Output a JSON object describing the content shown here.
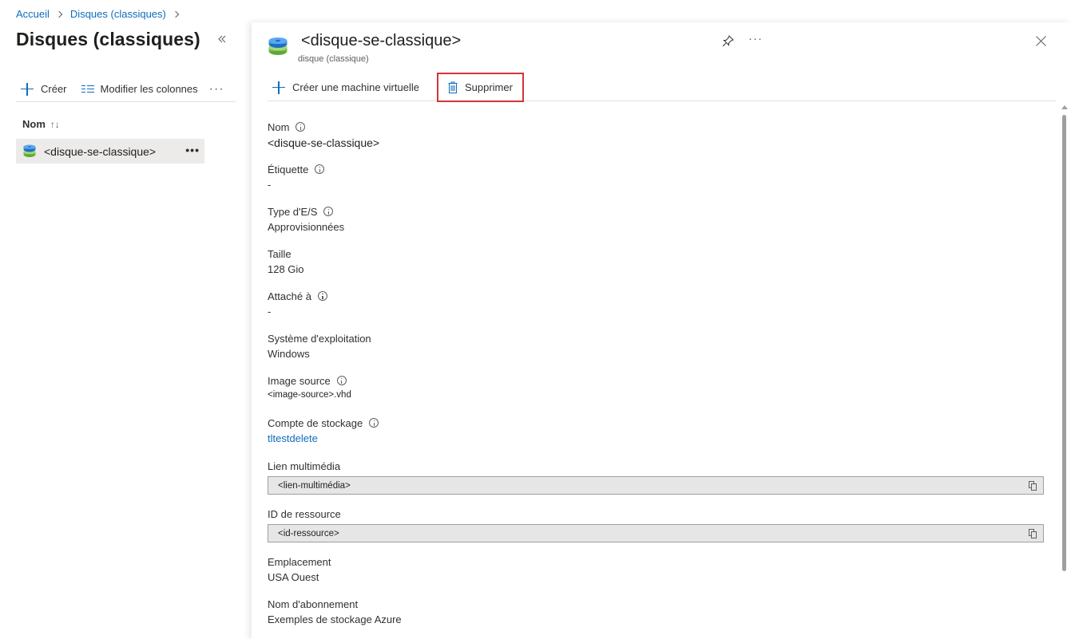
{
  "breadcrumb": {
    "items": [
      "Accueil",
      "Disques (classiques)"
    ]
  },
  "left_pane": {
    "title": "Disques (classiques)",
    "collapse_icon": "double-chevron-left-icon",
    "toolbar": {
      "create_label": "Créer",
      "edit_columns_label": "Modifier les colonnes",
      "more_label": "···"
    },
    "list_header": {
      "name_label": "Nom",
      "sort_icon": "↑↓"
    },
    "items": [
      {
        "label": "<disque-se-classique>",
        "more": "•••"
      }
    ]
  },
  "blade": {
    "title": "<disque-se-classique>",
    "subtitle": "disque (classique)",
    "more_label": "···",
    "toolbar": {
      "create_vm_label": "Créer une machine virtuelle",
      "delete_label": "Supprimer"
    },
    "properties": {
      "name": {
        "label": "Nom",
        "value": "<disque-se-classique>"
      },
      "tag": {
        "label": "Étiquette",
        "value": "-"
      },
      "io_type": {
        "label": "Type d'E/S",
        "value": "Approvisionnées"
      },
      "size": {
        "label": "Taille",
        "value": "128 Gio"
      },
      "attached_to": {
        "label": "Attaché à",
        "value": "-"
      },
      "os": {
        "label": "Système d'exploitation",
        "value": "Windows"
      },
      "source_image": {
        "label": "Image source",
        "value": "<image-source>.vhd"
      },
      "storage_account": {
        "label": "Compte de stockage",
        "value": "tltestdelete"
      },
      "media_link": {
        "label": "Lien multimédia",
        "value": "<lien-multimédia>"
      },
      "resource_id": {
        "label": "ID de ressource",
        "value": "<id-ressource>"
      },
      "location": {
        "label": "Emplacement",
        "value": "USA Ouest"
      },
      "subscription_name": {
        "label": "Nom d'abonnement",
        "value": "Exemples de stockage Azure"
      }
    }
  },
  "colors": {
    "link": "#0f6cbd",
    "highlight_border": "#d13438",
    "selected_row": "#edebe9"
  }
}
